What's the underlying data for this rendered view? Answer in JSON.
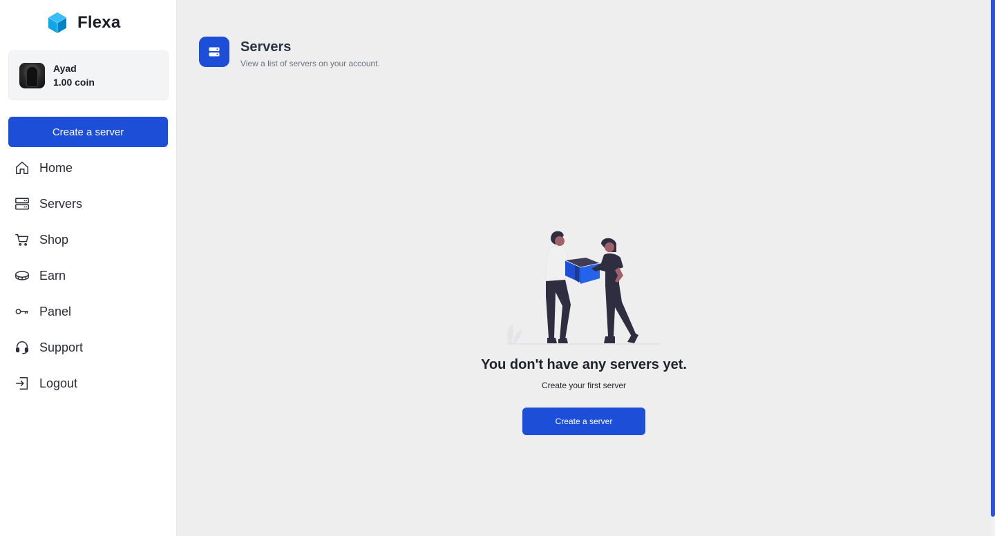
{
  "brand": {
    "name": "Flexa"
  },
  "user": {
    "name": "Ayad",
    "coins": "1.00 coin"
  },
  "sidebar": {
    "create_label": "Create a server",
    "items": [
      {
        "label": "Home",
        "icon": "home-icon"
      },
      {
        "label": "Servers",
        "icon": "servers-icon"
      },
      {
        "label": "Shop",
        "icon": "cart-icon"
      },
      {
        "label": "Earn",
        "icon": "coin-icon"
      },
      {
        "label": "Panel",
        "icon": "key-icon"
      },
      {
        "label": "Support",
        "icon": "headset-icon"
      },
      {
        "label": "Logout",
        "icon": "logout-icon"
      }
    ]
  },
  "header": {
    "title": "Servers",
    "subtitle": "View a list of servers on your account.",
    "icon": "server-icon"
  },
  "empty_state": {
    "title": "You don't have any servers yet.",
    "subtitle": "Create your first server",
    "button_label": "Create a server"
  },
  "colors": {
    "accent": "#1d4ed8",
    "sidebar_bg": "#ffffff",
    "main_bg": "#eeeeef",
    "scrollbar": "#2d4fe0"
  }
}
